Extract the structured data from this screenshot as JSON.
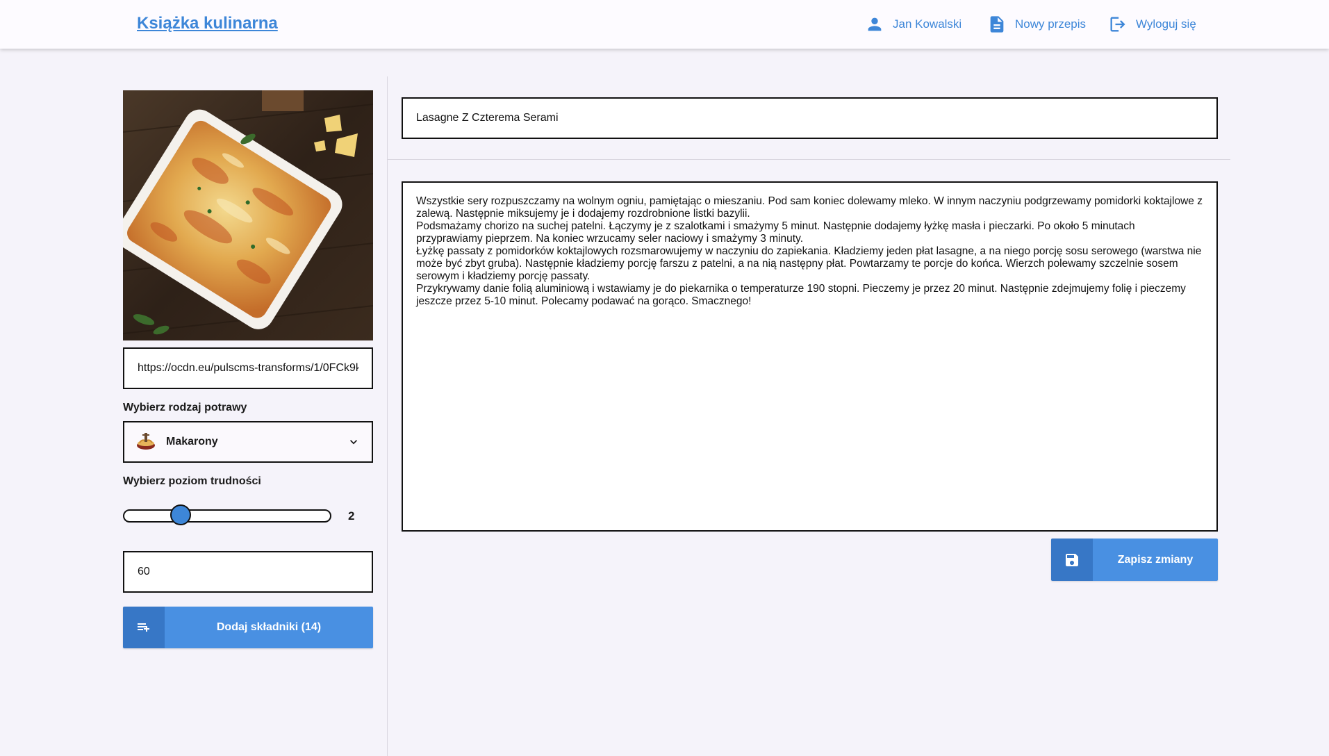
{
  "header": {
    "brand": "Książka kulinarna",
    "user_name": "Jan Kowalski",
    "new_recipe": "Nowy przepis",
    "logout": "Wyloguj się"
  },
  "recipe": {
    "image_url": "https://ocdn.eu/pulscms-transforms/1/0FCk9kpT",
    "title": "Lasagne Z Czterema Serami",
    "description": "Wszystkie sery rozpuszczamy na wolnym ogniu, pamiętając o mieszaniu. Pod sam koniec dolewamy mleko. W innym naczyniu podgrzewamy pomidorki koktajlowe z zalewą. Następnie miksujemy je i dodajemy rozdrobnione listki bazylii.\nPodsmażamy chorizo na suchej patelni. Łączymy je z szalotkami i smażymy 5 minut. Następnie dodajemy łyżkę masła i pieczarki. Po około 5 minutach przyprawiamy pieprzem. Na koniec wrzucamy seler naciowy i smażymy 3 minuty.\nŁyżkę passaty z pomidorków koktajlowych rozsmarowujemy w naczyniu do zapiekania. Kładziemy jeden płat lasagne, a na niego porcję sosu serowego (warstwa nie może być zbyt gruba). Następnie kładziemy porcję farszu z patelni, a na nią następny płat. Powtarzamy te porcje do końca. Wierzch polewamy szczelnie sosem serowym i kładziemy porcję passaty.\nPrzykrywamy danie folią aluminiową i wstawiamy je do piekarnika o temperaturze 190 stopni. Pieczemy je przez 20 minut. Następnie zdejmujemy folię i pieczemy jeszcze przez 5-10 minut. Polecamy podawać na gorąco. Smacznego!",
    "time": "60"
  },
  "form": {
    "dish_type_label": "Wybierz rodzaj potrawy",
    "dish_type_value": "Makarony",
    "difficulty_label": "Wybierz poziom trudności",
    "difficulty_value": "2",
    "difficulty_min": 1,
    "difficulty_max": 5,
    "ingredients_button": "Dodaj składniki (14)",
    "save_button": "Zapisz zmiany"
  },
  "icons": {
    "user": "user-icon",
    "new_recipe": "document-icon",
    "logout": "logout-icon",
    "dish": "pasta-bowl-icon",
    "chevron": "chevron-down-icon",
    "ingredients": "playlist-add-icon",
    "save": "floppy-disk-icon"
  },
  "colors": {
    "accent": "#4990e2",
    "accent_dark": "#3777c6",
    "link": "#3d86d8",
    "background": "#f5f3fa",
    "header_bg": "#fdfbff"
  }
}
